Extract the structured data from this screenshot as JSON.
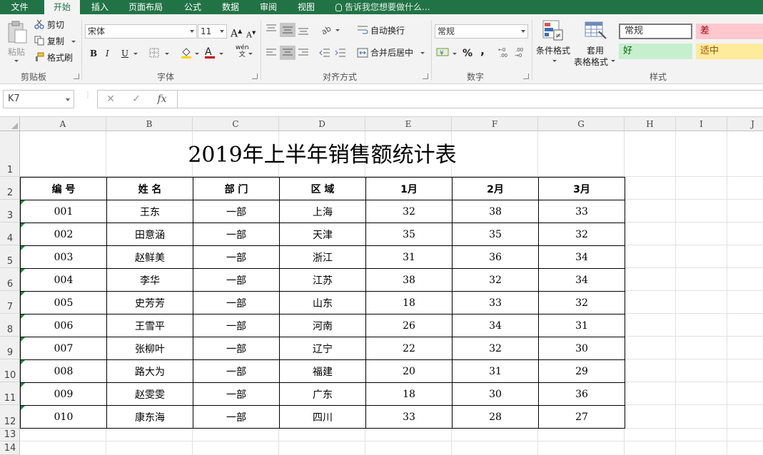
{
  "tabs": [
    {
      "label": "文件",
      "active": false
    },
    {
      "label": "开始",
      "active": true
    },
    {
      "label": "插入",
      "active": false
    },
    {
      "label": "页面布局",
      "active": false
    },
    {
      "label": "公式",
      "active": false
    },
    {
      "label": "数据",
      "active": false
    },
    {
      "label": "审阅",
      "active": false
    },
    {
      "label": "视图",
      "active": false
    }
  ],
  "tell_me": "告诉我您想要做什么...",
  "clipboard": {
    "paste": "粘贴",
    "cut": "剪切",
    "copy": "复制",
    "format_painter": "格式刷",
    "group": "剪贴板"
  },
  "font": {
    "name": "宋体",
    "size": "11",
    "group": "字体",
    "bold": "B",
    "italic": "I",
    "underline": "U",
    "wen": "wén"
  },
  "alignment": {
    "wrap_text": "自动换行",
    "merge_center": "合并后居中",
    "group": "对齐方式"
  },
  "number": {
    "format": "常规",
    "percent": "%",
    "comma": ",",
    "group": "数字"
  },
  "styles": {
    "conditional": "条件格式",
    "table_format_1": "套用",
    "table_format_2": "表格格式",
    "normal": "常规",
    "bad": "差",
    "good": "好",
    "neutral": "适中",
    "group": "样式",
    "colors": {
      "bad_bg": "#ffc7ce",
      "bad_fg": "#9c0006",
      "good_bg": "#c6efce",
      "good_fg": "#006100",
      "neutral_bg": "#ffeb9c",
      "neutral_fg": "#9c5700"
    }
  },
  "formula_bar": {
    "name_box": "K7",
    "cancel": "✕",
    "enter": "✓",
    "fx": "fx",
    "formula": ""
  },
  "columns": [
    "A",
    "B",
    "C",
    "D",
    "E",
    "F",
    "G",
    "H",
    "I",
    "J"
  ],
  "rows": [
    "1",
    "2",
    "3",
    "4",
    "5",
    "6",
    "7",
    "8",
    "9",
    "10",
    "11",
    "12",
    "13",
    "14"
  ],
  "sheet": {
    "title": "2019年上半年销售额统计表",
    "headers": [
      "编 号",
      "姓 名",
      "部 门",
      "区 域",
      "1月",
      "2月",
      "3月"
    ],
    "records": [
      [
        "001",
        "王东",
        "一部",
        "上海",
        "32",
        "38",
        "33"
      ],
      [
        "002",
        "田意涵",
        "一部",
        "天津",
        "35",
        "35",
        "32"
      ],
      [
        "003",
        "赵鲜美",
        "一部",
        "浙江",
        "31",
        "36",
        "34"
      ],
      [
        "004",
        "李华",
        "一部",
        "江苏",
        "38",
        "32",
        "34"
      ],
      [
        "005",
        "史芳芳",
        "一部",
        "山东",
        "18",
        "33",
        "32"
      ],
      [
        "006",
        "王雪平",
        "一部",
        "河南",
        "26",
        "34",
        "31"
      ],
      [
        "007",
        "张柳叶",
        "一部",
        "辽宁",
        "22",
        "32",
        "30"
      ],
      [
        "008",
        "路大为",
        "一部",
        "福建",
        "20",
        "31",
        "29"
      ],
      [
        "009",
        "赵雯雯",
        "一部",
        "广东",
        "18",
        "30",
        "36"
      ],
      [
        "010",
        "康东海",
        "一部",
        "四川",
        "33",
        "28",
        "27"
      ]
    ]
  }
}
